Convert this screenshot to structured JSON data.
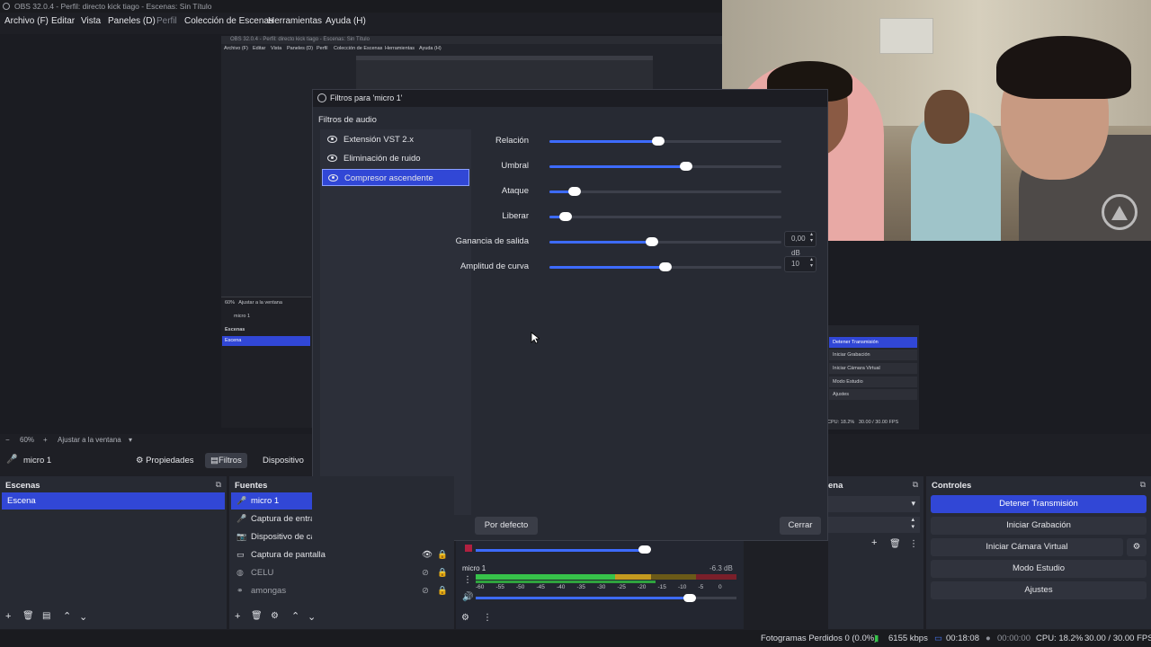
{
  "window": {
    "title": "OBS 32.0.4 - Perfil: directo kick tiago - Escenas: Sin Título"
  },
  "menu": [
    "Archivo (F)",
    "Editar",
    "Vista",
    "Paneles (D)",
    "Perfil",
    "Colección de Escenas",
    "Herramientas",
    "Ayuda (H)"
  ],
  "nested": {
    "title": "OBS 32.0.4 - Perfil: directo kick tiago - Escenas: Sin Título",
    "menu": [
      "Archivo (F)",
      "Editar",
      "Vista",
      "Paneles (D)",
      "Perfil",
      "Colección de Escenas",
      "Herramientas",
      "Ayuda (H)"
    ],
    "zoom": "60%",
    "fit": "Ajustar a la ventana",
    "source": "micro 1",
    "scenes_title": "Escenas",
    "scene": "Escena",
    "controls": [
      "Detener Transmisión",
      "Iniciar Grabación",
      "Iniciar Cámara Virtual",
      "Modo Estudio",
      "Ajustes"
    ],
    "cpu": "CPU: 18.2%",
    "fps": "30.00 / 30.00 FPS"
  },
  "filters_dialog": {
    "title": "Filtros para 'micro 1'",
    "section": "Filtros de audio",
    "filters": [
      {
        "name": "Extensión VST 2.x",
        "selected": false
      },
      {
        "name": "Eliminación de ruido",
        "selected": false
      },
      {
        "name": "Compresor ascendente",
        "selected": true
      }
    ],
    "params": [
      {
        "label": "Relación",
        "level": 0.47
      },
      {
        "label": "Umbral",
        "level": 0.59
      },
      {
        "label": "Ataque",
        "level": 0.11
      },
      {
        "label": "Liberar",
        "level": 0.07
      },
      {
        "label": "Ganancia de salida",
        "level": 0.44,
        "value": "0,00 dB"
      },
      {
        "label": "Amplitud de curva",
        "level": 0.5,
        "value": "10"
      }
    ],
    "default_button": "Por defecto",
    "close_button": "Cerrar"
  },
  "preview_toolbar": {
    "zoom_minus": "−",
    "zoom": "60%",
    "zoom_plus": "+",
    "fit": "Ajustar a la ventana"
  },
  "source_bar": {
    "name": "micro 1",
    "properties": "Propiedades",
    "filters": "Filtros",
    "device": "Dispositivo"
  },
  "scenes": {
    "title": "Escenas",
    "items": [
      "Escena"
    ]
  },
  "sources": {
    "title": "Fuentes",
    "items": [
      "micro 1",
      "Captura de entrada",
      "Dispositivo de captura",
      "Captura de pantalla",
      "CELU",
      "amongas"
    ]
  },
  "transitions": {
    "title": "ena"
  },
  "controls": {
    "title": "Controles",
    "buttons": [
      "Detener Transmisión",
      "Iniciar Grabación",
      "Iniciar Cámara Virtual",
      "Modo Estudio",
      "Ajustes"
    ]
  },
  "mixer": {
    "channel": "micro 1",
    "db": "-6.3 dB",
    "ticks": [
      "-60",
      "-55",
      "-50",
      "-45",
      "-40",
      "-35",
      "-30",
      "-25",
      "-20",
      "-15",
      "-10",
      "-5",
      "0"
    ],
    "volume_level": 0.82
  },
  "status": {
    "dropped": "Fotogramas Perdidos 0 (0.0%)",
    "bitrate": "6155 kbps",
    "stream_time": "00:18:08",
    "rec_time": "00:00:00",
    "cpu": "CPU: 18.2%",
    "fps": "30.00 / 30.00 FPS"
  },
  "colors": {
    "accent": "#3147d6",
    "panel": "#272a33",
    "slider": "#3d6bff"
  }
}
